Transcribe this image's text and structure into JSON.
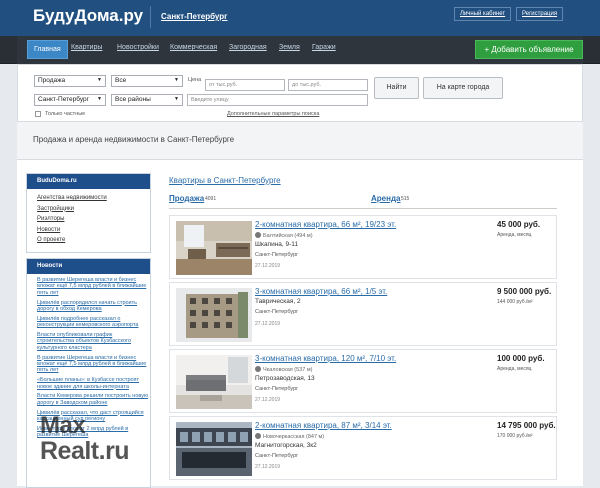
{
  "header": {
    "logo": "БудуДома.ру",
    "city": "Санкт-Петербург",
    "cabinet": "Личный кабинет",
    "register": "Регистрация"
  },
  "nav": {
    "items": [
      "Главная",
      "Квартиры",
      "Новостройки",
      "Коммерческая",
      "Загородная",
      "Земля",
      "Гаражи"
    ],
    "active": "Главная",
    "add_button": "+ Добавить объявление"
  },
  "search": {
    "deal": "Продажа",
    "type": "Все",
    "city": "Санкт-Петербург",
    "district": "Все районы",
    "price_label": "Цена",
    "price_from_placeholder": "от тыс.руб.",
    "price_to_placeholder": "до тыс.руб.",
    "street_placeholder": "Введите улицу",
    "find_button": "Найти",
    "map_button": "На карте города",
    "private_only": "Только частные",
    "extra_params": "Дополнительные параметры поиска"
  },
  "page_heading": "Продажа и аренда недвижимости в Санкт-Петербурге",
  "sidebar": {
    "site_title": "BuduDoma.ru",
    "links": [
      "Агентства недвижимости",
      "Застройщики",
      "Риэлторы",
      "Новости",
      "О проекте"
    ],
    "news_title": "Новости",
    "news": [
      "В развитие Шерегеша власти и бизнес вложат ещё 7,5 млрд рублей в ближайшие пять лет",
      "Цивилёв распорядился начать строить дорогу в обход Кемерова",
      "Цивилёв подробнее рассказал о реконструкции кемеровского аэропорта",
      "Власти опубликовали график строительства объектов Кузбасского культурного кластера",
      "В развитие Шерегеша власти и бизнес вложат ещё 7,5 млрд рублей в ближайшие пять лет",
      "«Большие планы»: в Кузбассе построят новое здание для школы-интерната",
      "Власти Кемерова решили построить новую дорогу в Заводском районе",
      "Цивилёв рассказал, что даст строящийся кассационный суд региону",
      "Инвесторы вложат 2 млрд рублей в развитие Шерегеша"
    ]
  },
  "listing": {
    "title": "Квартиры в Санкт-Петербурге",
    "tab_sale": "Продажа",
    "tab_sale_count": "4091",
    "tab_rent": "Аренда",
    "tab_rent_count": "515",
    "cards": [
      {
        "title": "2-комнатная квартира, 66 м², 19/23 эт.",
        "metro": "Балтийская (494 м)",
        "address": "Шкапина, 9-11",
        "city": "Санкт-Петербург",
        "date": "27.12.2019",
        "price": "45 000 руб.",
        "sub": "Аренда, месяц"
      },
      {
        "title": "3-комнатная квартира, 66 м², 1/5 эт.",
        "metro": "",
        "address": "Таврическая, 2",
        "city": "Санкт-Петербург",
        "date": "27.12.2019",
        "price": "9 500 000 руб.",
        "sub": "144 000 руб./м²"
      },
      {
        "title": "3-комнатная квартира, 120 м², 7/10 эт.",
        "metro": "Чкаловская (537 м)",
        "address": "Петрозаводская, 13",
        "city": "Санкт-Петербург",
        "date": "27.12.2019",
        "price": "100 000 руб.",
        "sub": "Аренда, месяц"
      },
      {
        "title": "2-комнатная квартира, 87 м², 3/14 эт.",
        "metro": "Новочеркасская (847 м)",
        "address": "Магнитогорская, 3к2",
        "city": "Санкт-Петербург",
        "date": "27.12.2019",
        "price": "14 795 000 руб.",
        "sub": "170 000 руб./м²"
      }
    ]
  },
  "watermark": {
    "line1": "Max",
    "line2": "Realt.ru"
  },
  "colors": {
    "header": "#214f80",
    "nav": "#2f353c",
    "accent": "#3c87c6",
    "add_button": "#2f9e3e",
    "link": "#2a6ca8"
  }
}
